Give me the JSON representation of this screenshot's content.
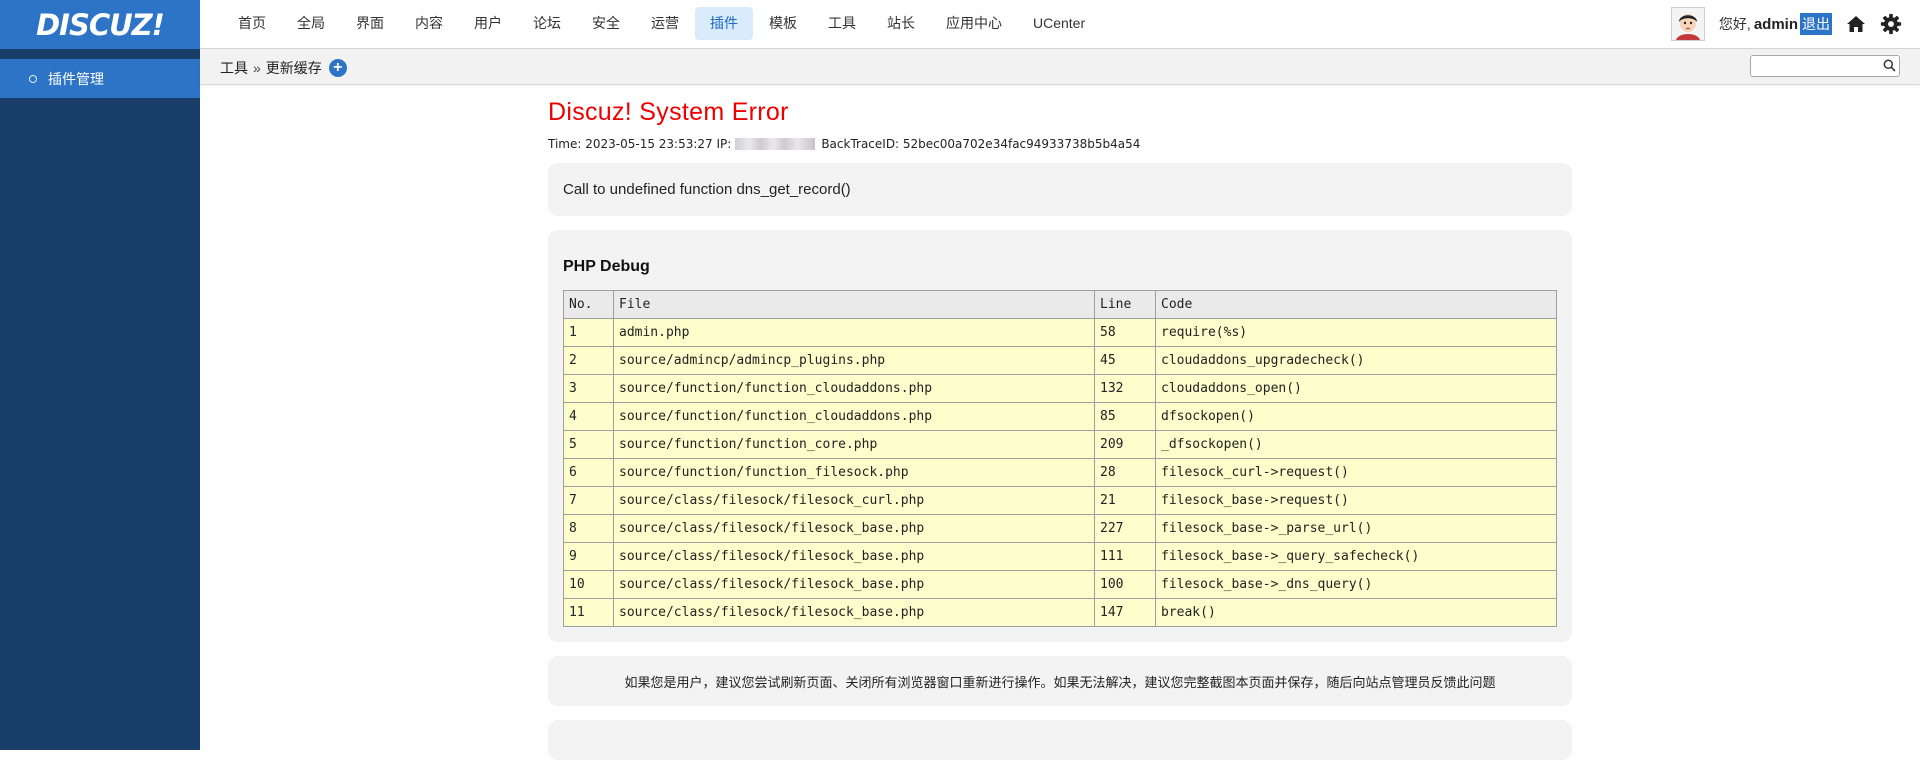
{
  "sidebar": {
    "logo": "DISCUZ!",
    "items": [
      {
        "label": "插件管理"
      }
    ]
  },
  "nav": {
    "items": [
      "首页",
      "全局",
      "界面",
      "内容",
      "用户",
      "论坛",
      "安全",
      "运营",
      "插件",
      "模板",
      "工具",
      "站长",
      "应用中心",
      "UCenter"
    ],
    "active": "插件"
  },
  "user": {
    "greeting": "您好,",
    "name": "admin",
    "logout": "退出",
    "icons": [
      "avatar",
      "home-icon",
      "gear-icon"
    ]
  },
  "subbar": {
    "breadcrumb": [
      "工具",
      "更新缓存"
    ],
    "separator": "»",
    "add_button": "+",
    "search_placeholder": ""
  },
  "error": {
    "title": "Discuz! System Error",
    "time_label": "Time: 2023-05-15 23:53:27 IP:",
    "backtrace_label": "BackTraceID: 52bec00a702e34fac94933738b5b4a54",
    "message": "Call to undefined function dns_get_record()"
  },
  "debug": {
    "title": "PHP Debug",
    "headers": [
      "No.",
      "File",
      "Line",
      "Code"
    ],
    "rows": [
      [
        "1",
        "admin.php",
        "58",
        "require(%s)"
      ],
      [
        "2",
        "source/admincp/admincp_plugins.php",
        "45",
        "cloudaddons_upgradecheck()"
      ],
      [
        "3",
        "source/function/function_cloudaddons.php",
        "132",
        "cloudaddons_open()"
      ],
      [
        "4",
        "source/function/function_cloudaddons.php",
        "85",
        "dfsockopen()"
      ],
      [
        "5",
        "source/function/function_core.php",
        "209",
        "_dfsockopen()"
      ],
      [
        "6",
        "source/function/function_filesock.php",
        "28",
        "filesock_curl->request()"
      ],
      [
        "7",
        "source/class/filesock/filesock_curl.php",
        "21",
        "filesock_base->request()"
      ],
      [
        "8",
        "source/class/filesock/filesock_base.php",
        "227",
        "filesock_base->_parse_url()"
      ],
      [
        "9",
        "source/class/filesock/filesock_base.php",
        "111",
        "filesock_base->_query_safecheck()"
      ],
      [
        "10",
        "source/class/filesock/filesock_base.php",
        "100",
        "filesock_base->_dns_query()"
      ],
      [
        "11",
        "source/class/filesock/filesock_base.php",
        "147",
        "break()"
      ]
    ]
  },
  "notice": "如果您是用户，建议您尝试刷新页面、关闭所有浏览器窗口重新进行操作。如果无法解决，建议您完整截图本页面并保存，随后向站点管理员反馈此问题",
  "colors": {
    "sidebar_bg": "#183d69",
    "accent": "#2d74c6",
    "nav_active_bg": "#d9ecfc",
    "error_red": "#ee0000",
    "table_row_bg": "#fefecc"
  }
}
